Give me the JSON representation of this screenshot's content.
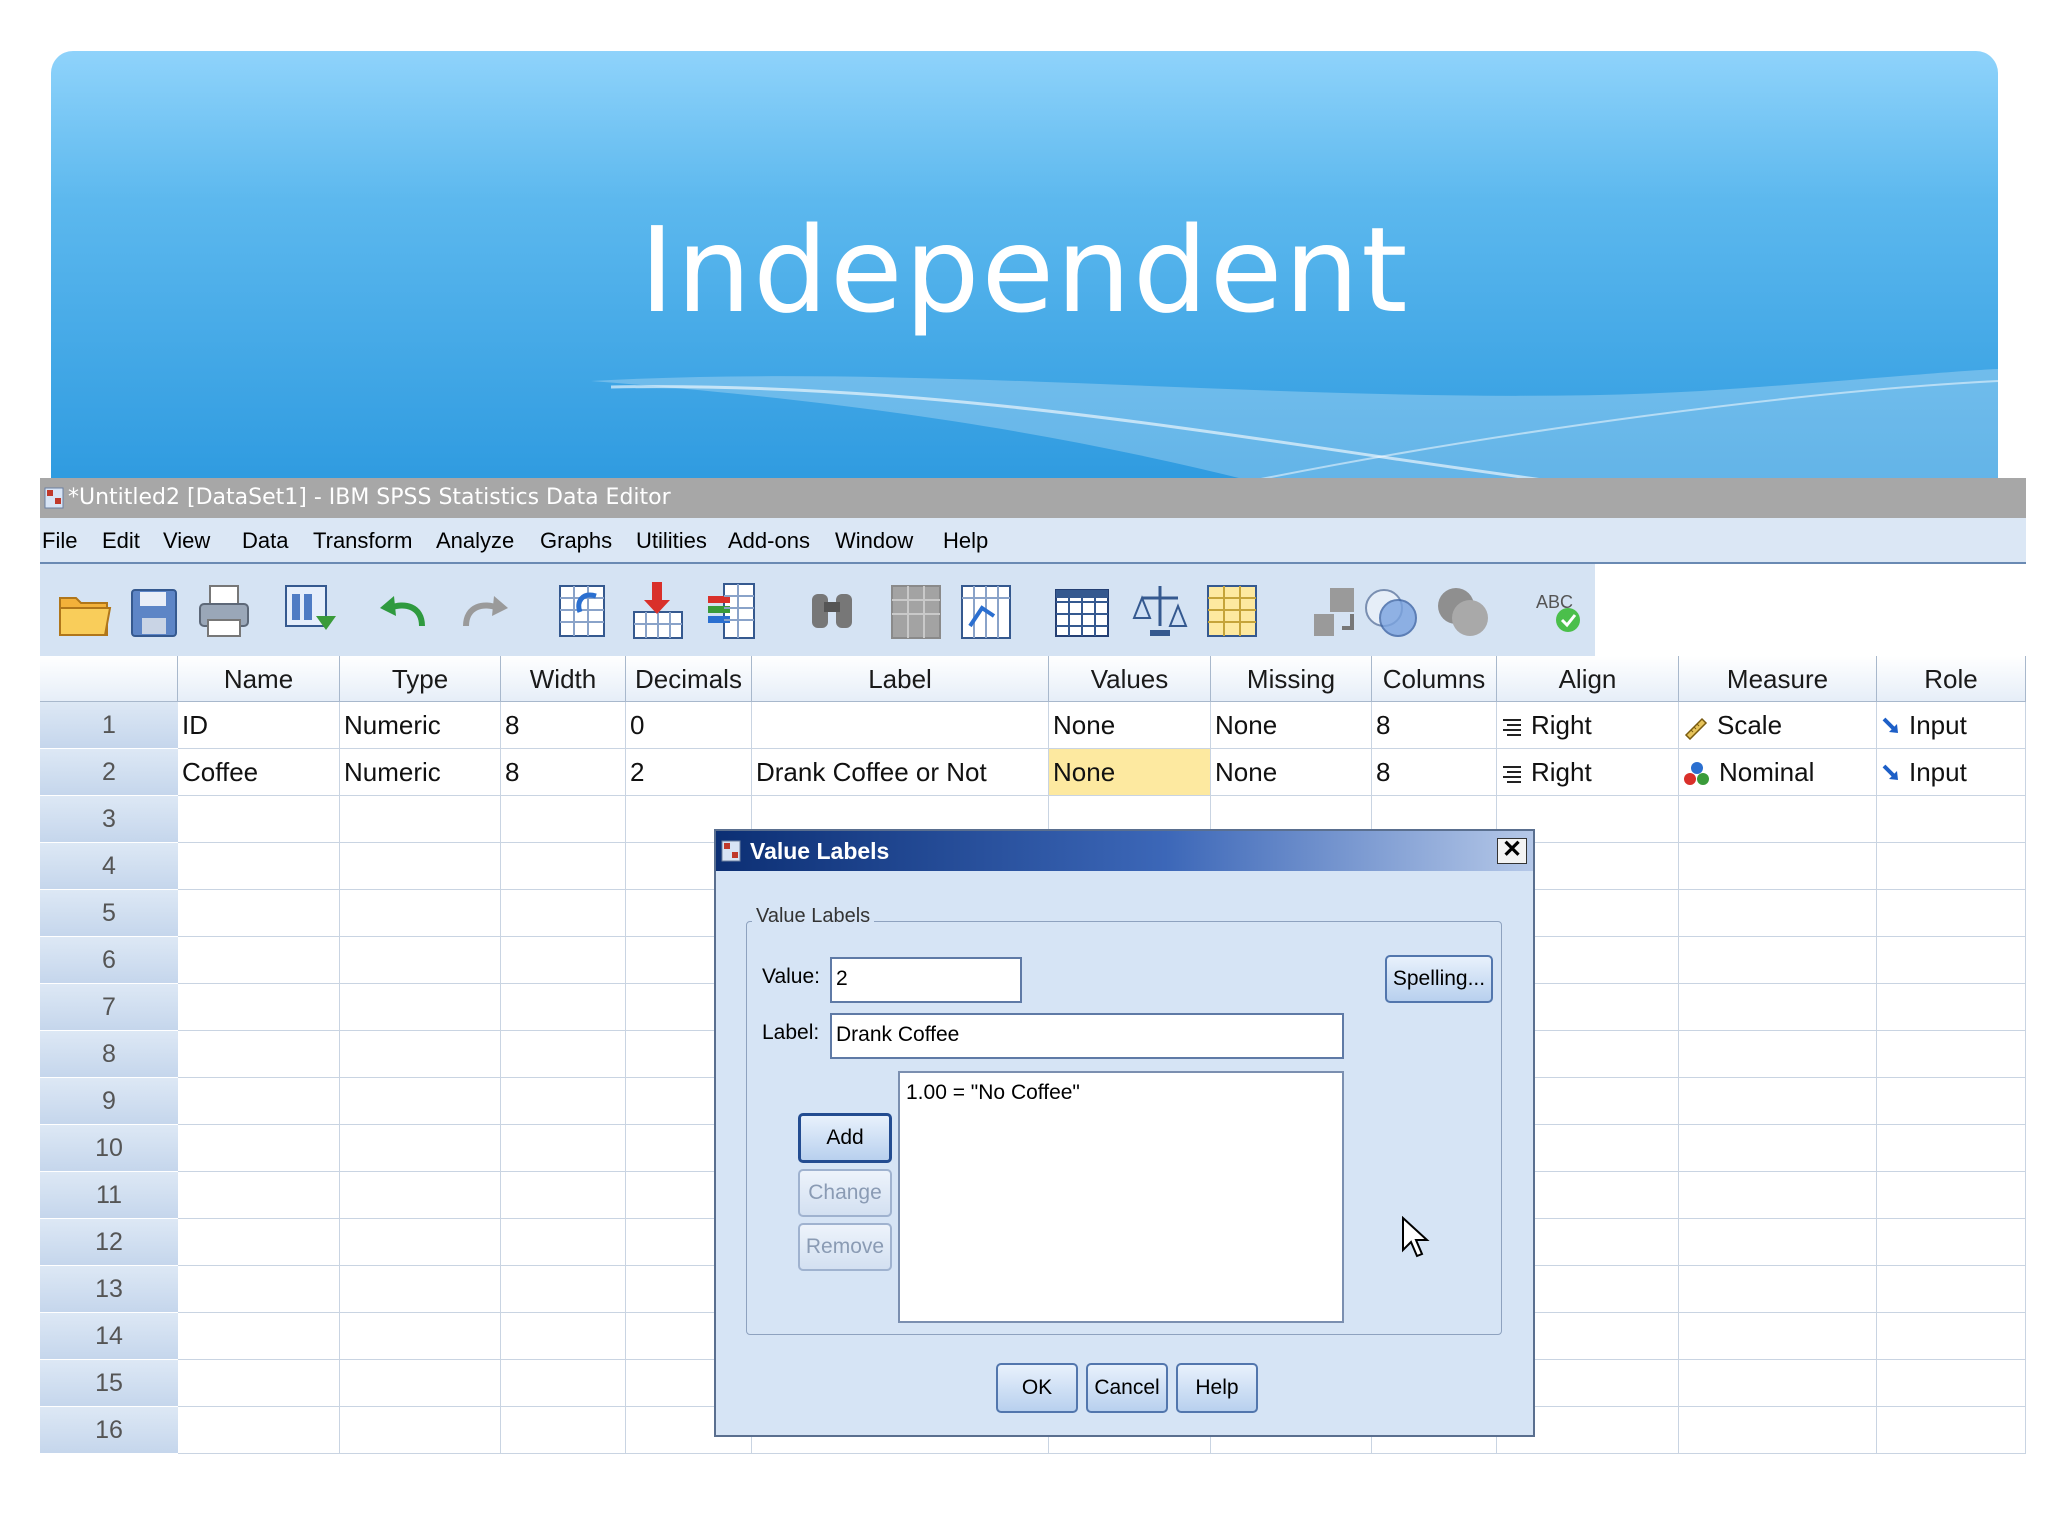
{
  "slide": {
    "title": "Independent"
  },
  "window": {
    "title": "*Untitled2 [DataSet1] - IBM SPSS Statistics Data Editor",
    "menu": [
      "File",
      "Edit",
      "View",
      "Data",
      "Transform",
      "Analyze",
      "Graphs",
      "Utilities",
      "Add-ons",
      "Window",
      "Help"
    ]
  },
  "toolbar": {
    "icons": [
      "open-folder-icon",
      "save-icon",
      "print-icon",
      "dialog-recall-icon",
      "undo-icon",
      "redo-icon",
      "goto-case-icon",
      "goto-variable-icon",
      "variables-icon",
      "find-icon",
      "insert-cases-icon",
      "insert-variable-icon",
      "split-file-icon",
      "weight-cases-icon",
      "select-cases-icon",
      "value-labels-icon",
      "use-sets-icon",
      "show-all-variables-icon",
      "spell-check-icon"
    ]
  },
  "grid": {
    "columns": [
      "Name",
      "Type",
      "Width",
      "Decimals",
      "Label",
      "Values",
      "Missing",
      "Columns",
      "Align",
      "Measure",
      "Role"
    ],
    "rows": [
      {
        "num": "1",
        "cells": [
          "ID",
          "Numeric",
          "8",
          "0",
          "",
          "None",
          "None",
          "8",
          "Right",
          "Scale",
          "Input"
        ],
        "measure_icon": "scale-ruler-icon"
      },
      {
        "num": "2",
        "cells": [
          "Coffee",
          "Numeric",
          "8",
          "2",
          "Drank Coffee or Not",
          "None",
          "None",
          "8",
          "Right",
          "Nominal",
          "Input"
        ],
        "measure_icon": "nominal-circles-icon"
      }
    ],
    "empty_rows": [
      "3",
      "4",
      "5",
      "6",
      "7",
      "8",
      "9",
      "10",
      "11",
      "12",
      "13",
      "14",
      "15",
      "16"
    ]
  },
  "dialog": {
    "title": "Value Labels",
    "group_title": "Value Labels",
    "value_label": "Value:",
    "value": "2",
    "label_label": "Label:",
    "label": "Drank Coffee",
    "list_items": [
      "1.00 = \"No Coffee\""
    ],
    "spelling": "Spelling...",
    "add": "Add",
    "change": "Change",
    "remove": "Remove",
    "ok": "OK",
    "cancel": "Cancel",
    "help": "Help",
    "close": "✕"
  },
  "colors": {
    "banner": "#2f9be0",
    "highlight": "#fde9a0",
    "dialog_title": "#0c2f74"
  }
}
